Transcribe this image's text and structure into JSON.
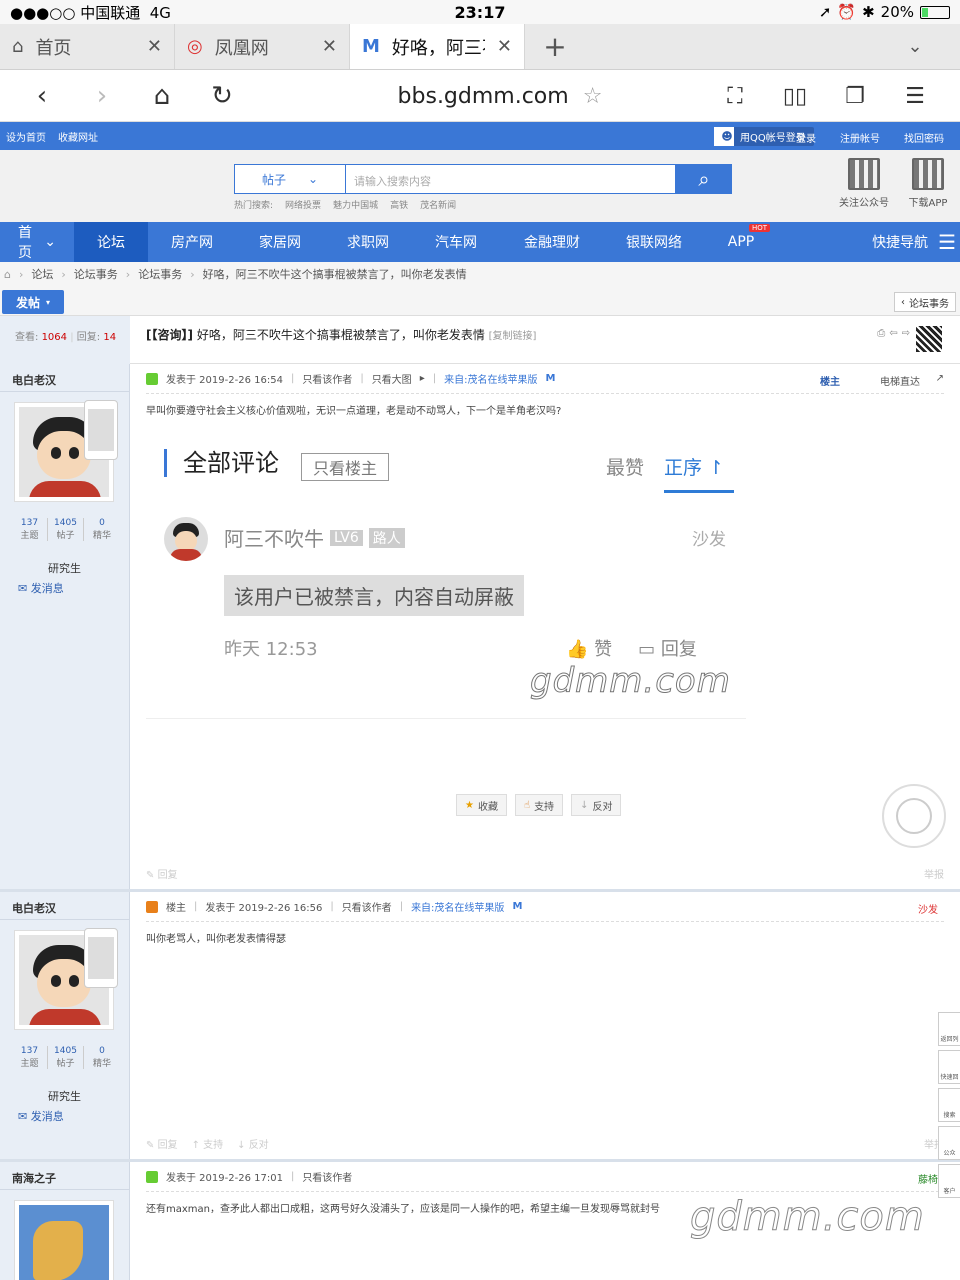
{
  "statusbar": {
    "carrier": "●●●○○ 中国联通",
    "network": "4G",
    "time": "23:17",
    "battery": "20%"
  },
  "tabs": [
    {
      "label": "首页",
      "icon": "home-icon"
    },
    {
      "label": "凤凰网",
      "icon": "phoenix-icon"
    },
    {
      "label": "好咯，阿三不",
      "icon": "gdmm-icon"
    }
  ],
  "address": {
    "url": "bbs.gdmm.com"
  },
  "topbar": {
    "set_home": "设为首页",
    "bookmark": "收藏网址",
    "qq_login": "用QQ帐号登录",
    "login": "登录",
    "register": "注册帐号",
    "forgot": "找回密码"
  },
  "search": {
    "scope": "帖子",
    "placeholder": "请输入搜索内容",
    "hot_label": "热门搜索:",
    "hot": [
      "网络投票",
      "魅力中国城",
      "高铁",
      "茂名新闻"
    ],
    "follow": "关注公众号",
    "download": "下载APP"
  },
  "nav": {
    "items": [
      "首页",
      "论坛",
      "房产网",
      "家居网",
      "求职网",
      "汽车网",
      "金融理财",
      "银联网络",
      "APP"
    ],
    "hot": "HOT",
    "quick": "快捷导航"
  },
  "breadcrumb": [
    "论坛",
    "论坛事务",
    "论坛事务",
    "好咯，阿三不吹牛这个搞事棍被禁言了，叫你老发表情"
  ],
  "actions": {
    "post": "发帖",
    "back": "论坛事务"
  },
  "thread": {
    "views_label": "查看:",
    "views": "1064",
    "replies_label": "回复:",
    "replies": "14",
    "category": "[【咨询】]",
    "title": "好咯，阿三不吹牛这个搞事棍被禁言了，叫你老发表情",
    "copy": "[复制链接]"
  },
  "posts": [
    {
      "user": "电白老汉",
      "threads": "137",
      "threads_label": "主题",
      "posts": "1405",
      "posts_label": "帖子",
      "digest": "0",
      "digest_label": "精华",
      "rank": "研究生",
      "msg": "发消息",
      "role": "",
      "date": "发表于 2019-2-26 16:54",
      "only_author": "只看该作者",
      "big_img": "只看大图",
      "source": "来自:茂名在线苹果版",
      "floor": "楼主",
      "elevator": "电梯直达",
      "text": "早叫你要遵守社会主义核心价值观啦，无识一点道理，老是动不动骂人，下一个是羊角老汉吗?",
      "shot": {
        "heading": "全部评论",
        "only_host": "只看楼主",
        "best": "最赞",
        "order": "正序",
        "name": "阿三不吹牛",
        "lv": "LV6",
        "role": "路人",
        "sofa": "沙发",
        "banned": "该用户已被禁言，内容自动屏蔽",
        "time": "昨天 12:53",
        "like": "赞",
        "reply": "回复",
        "watermark": "gdmm.com"
      },
      "vote": {
        "fav": "收藏",
        "support": "支持",
        "against": "反对"
      },
      "foot": {
        "reply": "回复",
        "report": "举报"
      }
    },
    {
      "user": "电白老汉",
      "threads": "137",
      "threads_label": "主题",
      "posts": "1405",
      "posts_label": "帖子",
      "digest": "0",
      "digest_label": "精华",
      "rank": "研究生",
      "msg": "发消息",
      "role": "楼主",
      "date": "发表于 2019-2-26 16:56",
      "only_author": "只看该作者",
      "source": "来自:茂名在线苹果版",
      "floor": "沙发",
      "text": "叫你老骂人，叫你老发表情得瑟",
      "foot": {
        "reply": "回复",
        "support": "支持",
        "against": "反对",
        "report": "举报"
      }
    },
    {
      "user": "南海之子",
      "date": "发表于 2019-2-26 17:01",
      "only_author": "只看该作者",
      "floor": "藤椅",
      "text": "还有maxman，查矛此人都出口成粗，这两号好久没浦头了，应该是同一人操作的吧，希望主编一旦发现辱骂就封号"
    }
  ],
  "side_tools": [
    "返回列",
    "快速回",
    "搜索",
    "公众",
    "客户"
  ],
  "watermark": "gdmm.com"
}
